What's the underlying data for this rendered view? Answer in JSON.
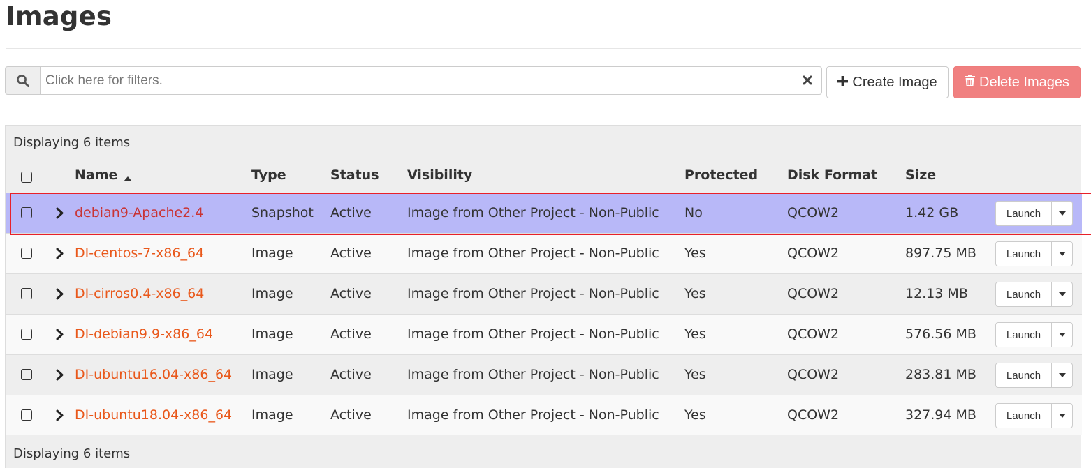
{
  "page": {
    "title": "Images"
  },
  "toolbar": {
    "search_placeholder": "Click here for filters.",
    "search_icon": "search-icon",
    "clear_icon": "close-icon",
    "create_label": "Create Image",
    "create_icon": "plus-icon",
    "delete_label": "Delete Images",
    "delete_icon": "trash-icon"
  },
  "table": {
    "count_top": "Displaying 6 items",
    "count_bottom": "Displaying 6 items",
    "columns": {
      "name": "Name",
      "type": "Type",
      "status": "Status",
      "visibility": "Visibility",
      "protected": "Protected",
      "disk_format": "Disk Format",
      "size": "Size"
    },
    "sort_indicator": "caret-up-icon",
    "action_label": "Launch",
    "rows": [
      {
        "name": "debian9-Apache2.4",
        "type": "Snapshot",
        "status": "Active",
        "visibility": "Image from Other Project - Non-Public",
        "protected": "No",
        "disk_format": "QCOW2",
        "size": "1.42 GB",
        "selected": true
      },
      {
        "name": "DI-centos-7-x86_64",
        "type": "Image",
        "status": "Active",
        "visibility": "Image from Other Project - Non-Public",
        "protected": "Yes",
        "disk_format": "QCOW2",
        "size": "897.75 MB"
      },
      {
        "name": "DI-cirros0.4-x86_64",
        "type": "Image",
        "status": "Active",
        "visibility": "Image from Other Project - Non-Public",
        "protected": "Yes",
        "disk_format": "QCOW2",
        "size": "12.13 MB"
      },
      {
        "name": "DI-debian9.9-x86_64",
        "type": "Image",
        "status": "Active",
        "visibility": "Image from Other Project - Non-Public",
        "protected": "Yes",
        "disk_format": "QCOW2",
        "size": "576.56 MB"
      },
      {
        "name": "DI-ubuntu16.04-x86_64",
        "type": "Image",
        "status": "Active",
        "visibility": "Image from Other Project - Non-Public",
        "protected": "Yes",
        "disk_format": "QCOW2",
        "size": "283.81 MB"
      },
      {
        "name": "DI-ubuntu18.04-x86_64",
        "type": "Image",
        "status": "Active",
        "visibility": "Image from Other Project - Non-Public",
        "protected": "Yes",
        "disk_format": "QCOW2",
        "size": "327.94 MB"
      }
    ]
  },
  "colors": {
    "link": "#e9581b",
    "selected_row": "#b8b8f8",
    "highlight_border": "#e8202a",
    "delete_button": "#f08080"
  }
}
